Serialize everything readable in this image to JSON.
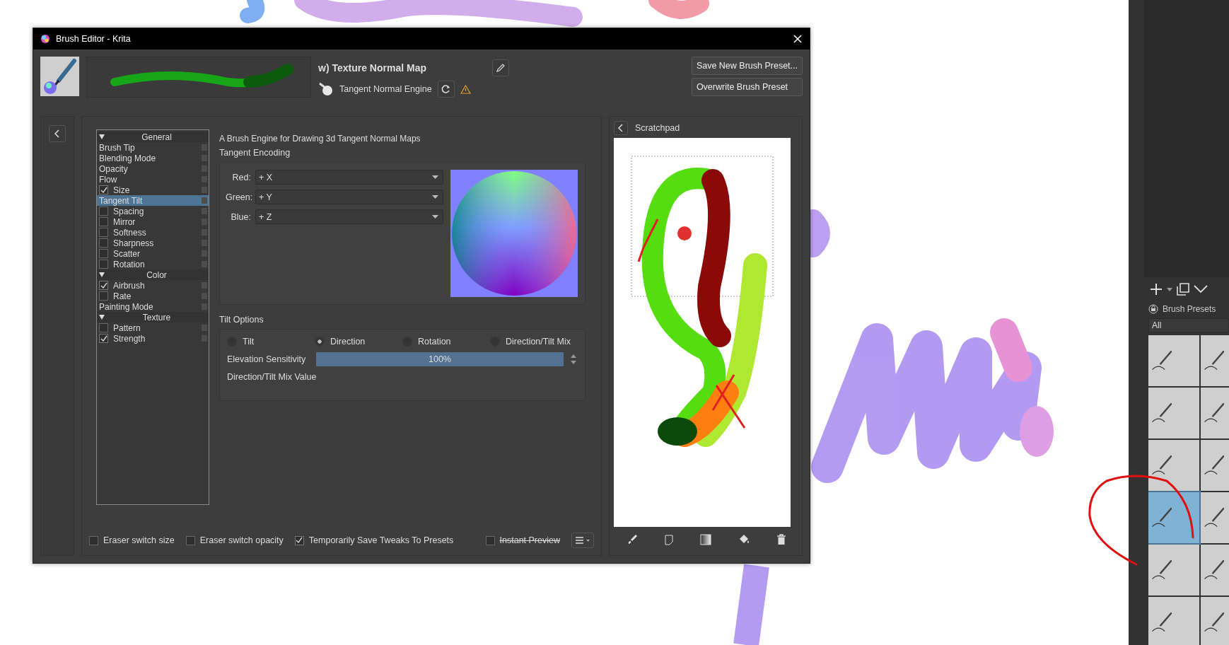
{
  "window": {
    "title": "Brush Editor - Krita"
  },
  "header": {
    "preset_name": "w) Texture Normal Map",
    "engine": "Tangent Normal Engine",
    "buttons": [
      "Save New Brush Preset...",
      "Overwrite Brush Preset"
    ]
  },
  "tree": [
    {
      "label": "General",
      "selected": false,
      "children": [
        {
          "label": "Brush Tip",
          "kind": "plain",
          "selected": false
        },
        {
          "label": "Blending Mode",
          "kind": "plain",
          "selected": false
        },
        {
          "label": "Opacity",
          "kind": "plain",
          "selected": false
        },
        {
          "label": "Flow",
          "kind": "plain",
          "selected": false
        },
        {
          "label": "Size",
          "kind": "check",
          "checked": true,
          "selected": false
        },
        {
          "label": "Tangent Tilt",
          "kind": "plain",
          "selected": true
        },
        {
          "label": "Spacing",
          "kind": "check",
          "checked": false,
          "selected": false
        },
        {
          "label": "Mirror",
          "kind": "check",
          "checked": false,
          "selected": false
        },
        {
          "label": "Softness",
          "kind": "check",
          "checked": false,
          "selected": false
        },
        {
          "label": "Sharpness",
          "kind": "check",
          "checked": false,
          "selected": false
        },
        {
          "label": "Scatter",
          "kind": "check",
          "checked": false,
          "selected": false
        },
        {
          "label": "Rotation",
          "kind": "check",
          "checked": false,
          "selected": false
        }
      ]
    },
    {
      "label": "Color",
      "selected": false,
      "children": [
        {
          "label": "Airbrush",
          "kind": "check",
          "checked": true,
          "selected": false
        },
        {
          "label": "Rate",
          "kind": "check",
          "checked": false,
          "selected": false
        },
        {
          "label": "Painting Mode",
          "kind": "plain",
          "selected": false
        }
      ]
    },
    {
      "label": "Texture",
      "selected": false,
      "children": [
        {
          "label": "Pattern",
          "kind": "check",
          "checked": false,
          "selected": false
        },
        {
          "label": "Strength",
          "kind": "check",
          "checked": true,
          "selected": false
        }
      ]
    }
  ],
  "options": {
    "description": "A Brush Engine for Drawing 3d Tangent Normal Maps",
    "encoding_title": "Tangent Encoding",
    "encoding": [
      {
        "label": "Red:",
        "value": "+ X"
      },
      {
        "label": "Green:",
        "value": "+ Y"
      },
      {
        "label": "Blue:",
        "value": "+ Z"
      }
    ],
    "tilt_title": "Tilt Options",
    "tilt_modes": [
      {
        "label": "Tilt",
        "selected": false
      },
      {
        "label": "Direction",
        "selected": true
      },
      {
        "label": "Rotation",
        "selected": false
      },
      {
        "label": "Direction/Tilt Mix",
        "selected": false
      }
    ],
    "elevation": {
      "label": "Elevation Sensitivity",
      "reading": "100%",
      "level": 1
    },
    "mix_label": "Direction/Tilt Mix Value"
  },
  "scratchpad": {
    "title": "Scratchpad"
  },
  "footer": {
    "checks": [
      {
        "label": "Eraser switch size",
        "checked": false
      },
      {
        "label": "Eraser switch opacity",
        "checked": false
      },
      {
        "label": "Temporarily Save Tweaks To Presets",
        "checked": true
      }
    ],
    "instant_preview": {
      "label": "Instant Preview",
      "checked": false
    }
  },
  "docker": {
    "title": "Brush Presets",
    "filter": "All",
    "presets": [
      {
        "selected": false
      },
      {
        "selected": false
      },
      {
        "selected": false
      },
      {
        "selected": false
      },
      {
        "selected": false
      },
      {
        "selected": false
      },
      {
        "selected": true
      },
      {
        "selected": false
      },
      {
        "selected": false
      },
      {
        "selected": false
      },
      {
        "selected": false
      },
      {
        "selected": false
      }
    ]
  }
}
